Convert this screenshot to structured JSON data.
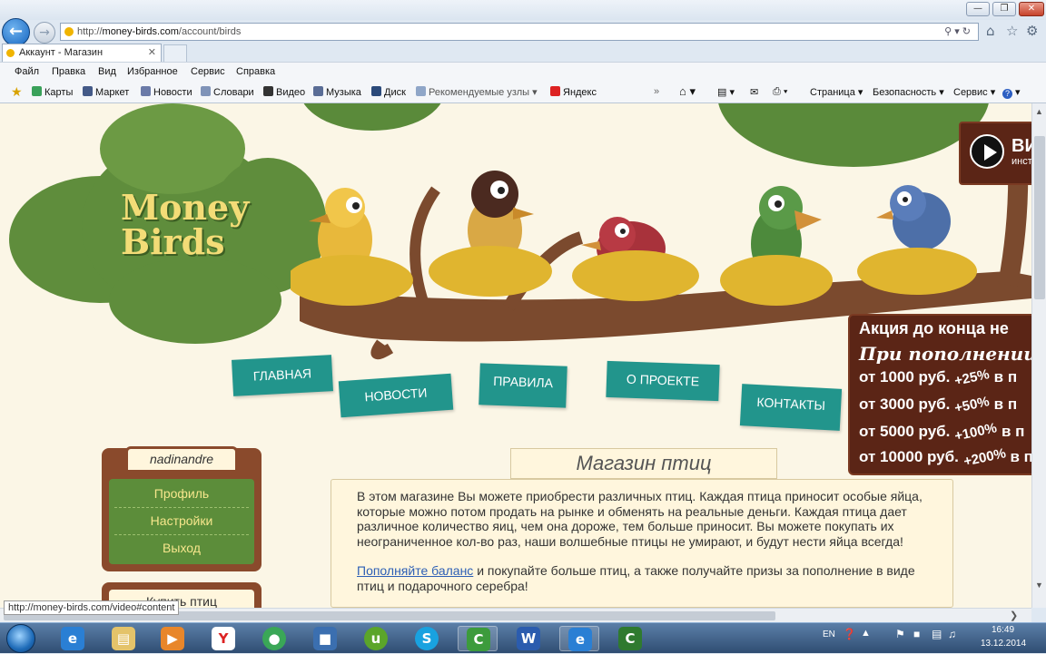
{
  "browser": {
    "url_prefix": "http://",
    "url_domain": "money-birds.com",
    "url_path": "/account/birds",
    "tab_title": "Аккаунт - Магазин",
    "status_url": "http://money-birds.com/video#content",
    "window_controls": [
      "—",
      "❐",
      "✕"
    ],
    "menu": [
      "Файл",
      "Правка",
      "Вид",
      "Избранное",
      "Сервис",
      "Справка"
    ],
    "favorites": [
      "Карты",
      "Маркет",
      "Новости",
      "Словари",
      "Видео",
      "Музыка",
      "Диск",
      "Рекомендуемые узлы ▾",
      "Яндекс"
    ],
    "command_bar": [
      "Страница ▾",
      "Безопасность ▾",
      "Сервис ▾"
    ]
  },
  "site": {
    "logo_line1": "Money",
    "logo_line2": "Birds",
    "nav": [
      "ГЛАВНАЯ",
      "НОВОСТИ",
      "ПРАВИЛА",
      "О ПРОЕКТЕ",
      "КОНТАКТЫ"
    ],
    "video_label": "ВИ",
    "video_sub": "инст",
    "promo": {
      "title": "Акция до конца не",
      "subtitle": "При пополнении",
      "rows": [
        {
          "amount": "от 1000 руб.",
          "bonus": "+25%",
          "tail": "в п"
        },
        {
          "amount": "от 3000 руб.",
          "bonus": "+50%",
          "tail": "в п"
        },
        {
          "amount": "от 5000 руб.",
          "bonus": "+100%",
          "tail": "в п"
        },
        {
          "amount": "от 10000 руб.",
          "bonus": "+200%",
          "tail": "в п"
        }
      ]
    },
    "user": {
      "name": "nadinandre",
      "menu": [
        "Профиль",
        "Настройки",
        "Выход"
      ],
      "next_block": "Купить птиц"
    },
    "shop": {
      "title": "Магазин птиц",
      "paragraph1": "В этом магазине Вы можете приобрести различных птиц. Каждая птица приносит особые яйца, которые можно потом продать на рынке и обменять на реальные деньги. Каждая птица дает различное количество яиц, чем она дороже, тем больше приносит. Вы можете покупать их неограниченное кол-во раз, наши волшебные птицы не умирают, и будут нести яйца всегда!",
      "link": "Пополняйте баланс",
      "paragraph2": " и покупайте больше птиц, а также получайте призы за пополнение в виде птиц и подарочного серебра!"
    },
    "colors": {
      "teal": "#22958c",
      "tree_green": "#5f8d3c",
      "branch": "#7b4a2e",
      "promo_bg": "#5b2516"
    }
  },
  "taskbar": {
    "lang": "EN",
    "time": "16:49",
    "date": "13.12.2014"
  }
}
